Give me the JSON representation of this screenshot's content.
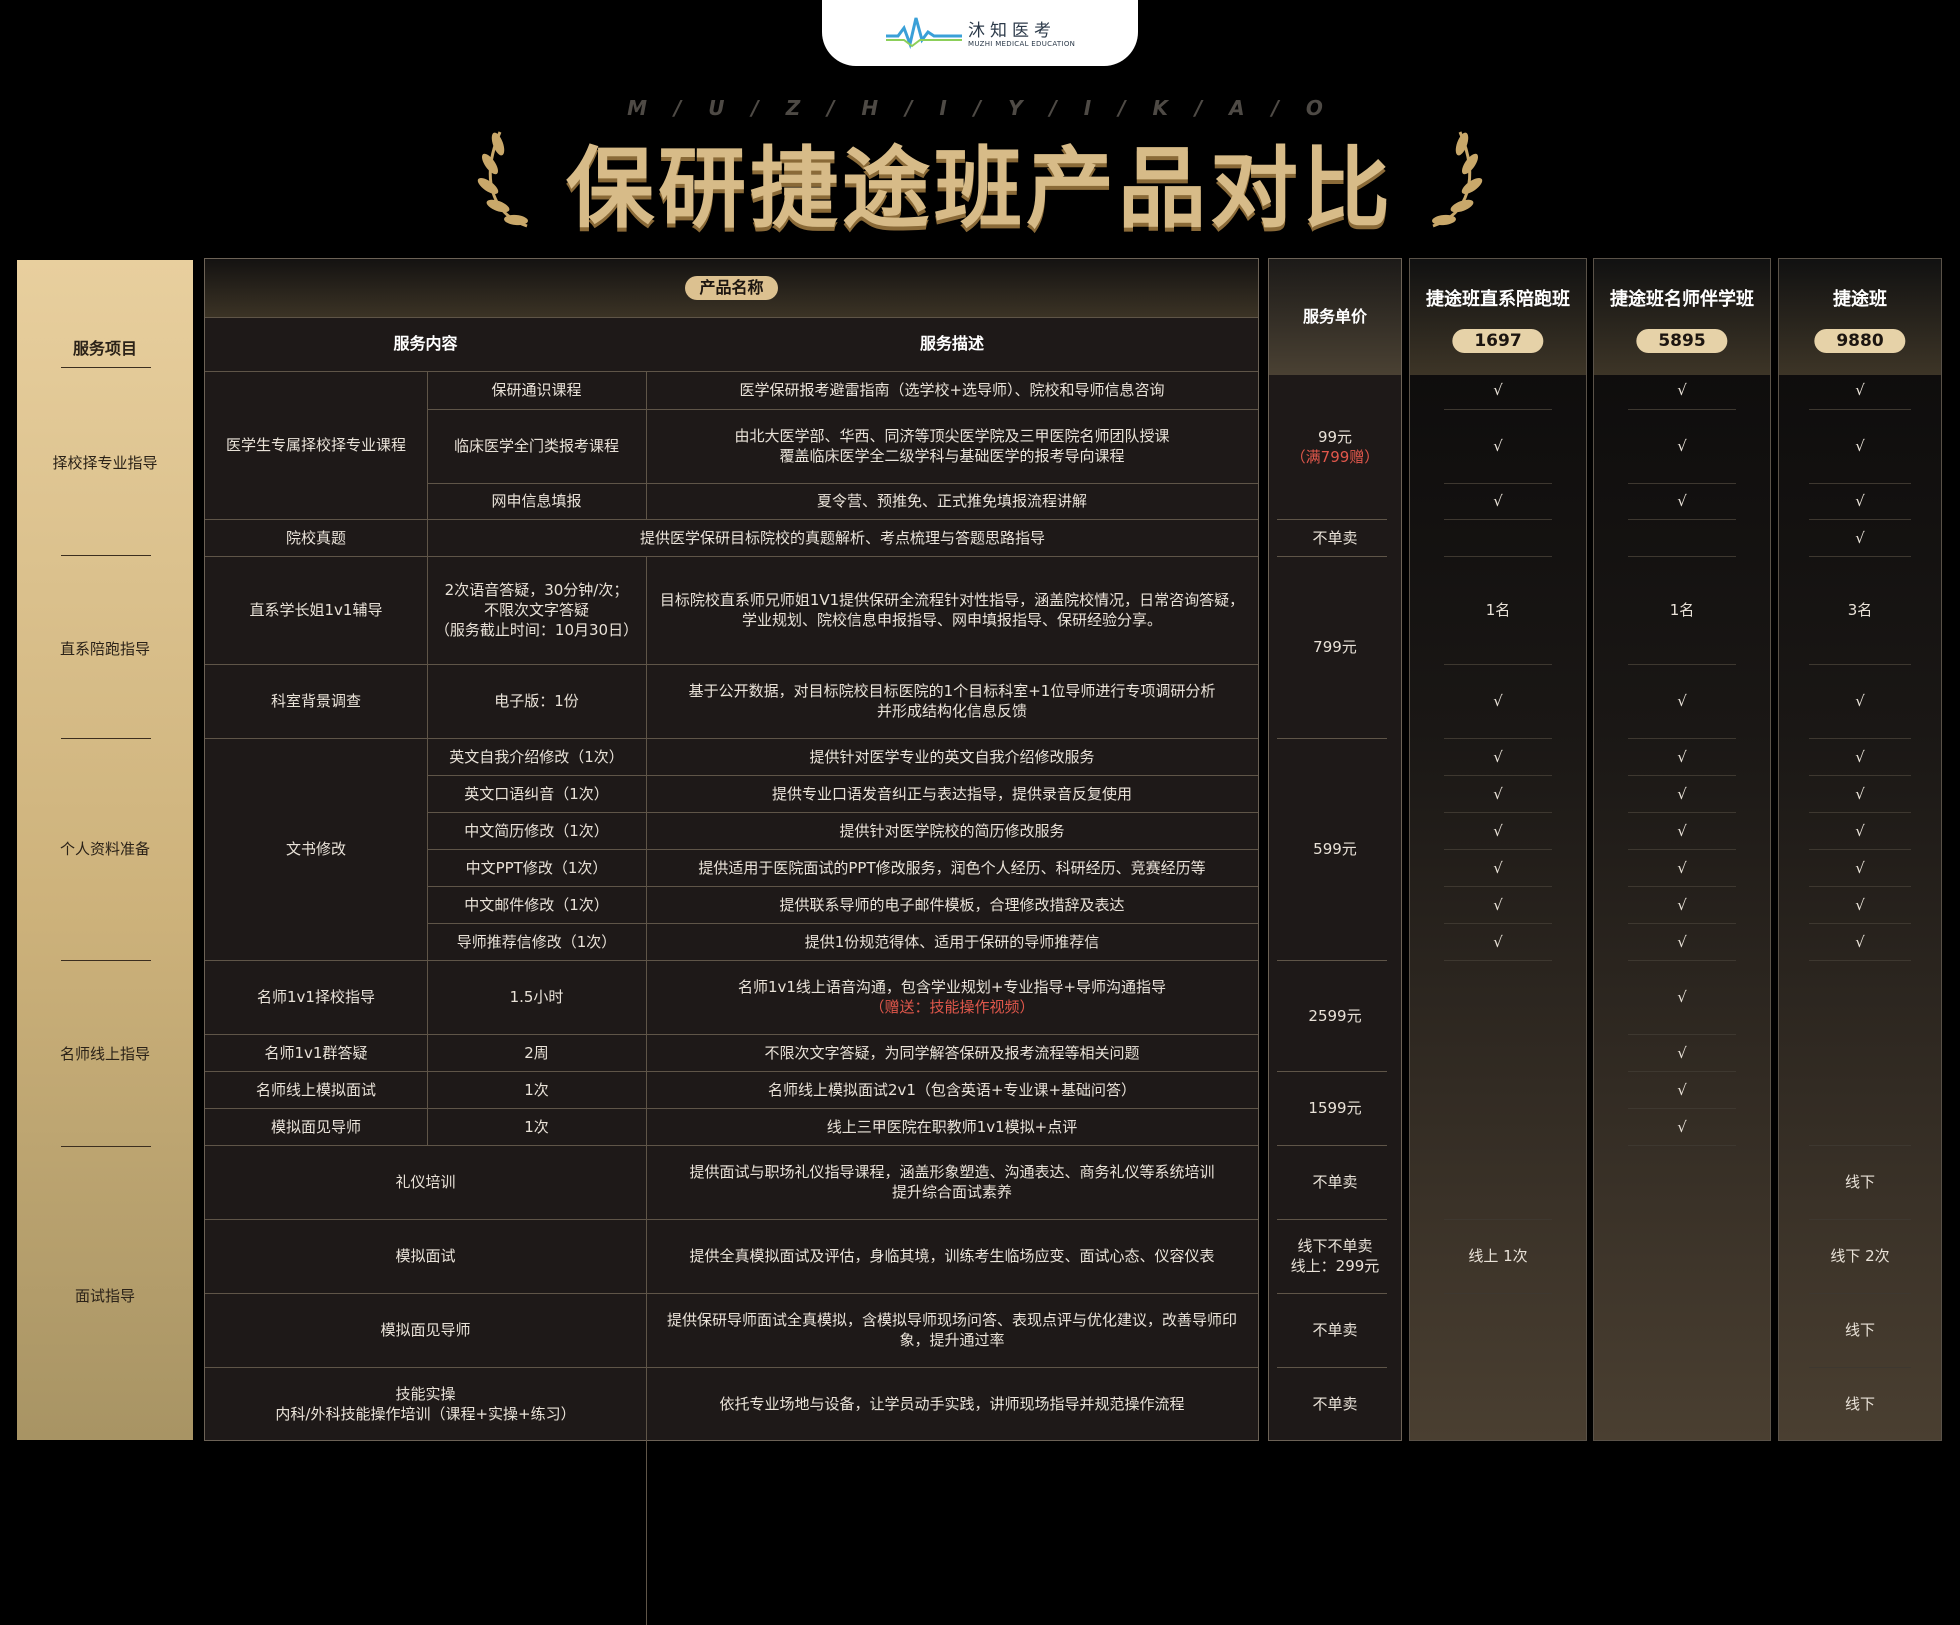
{
  "logo": {
    "name_cn": "沐知医考",
    "name_en": "MUZHI MEDICAL EDUCATION"
  },
  "header": {
    "spaced": "M / U / Z / H / I / Y / I / K / A / O",
    "title": "保研捷途班产品对比"
  },
  "left": {
    "head": "服务项目",
    "sections": [
      "择校择专业指导",
      "直系陪跑指导",
      "个人资料准备",
      "名师线上指导",
      "面试指导"
    ]
  },
  "table": {
    "product_label": "产品名称",
    "col_content": "服务内容",
    "col_desc": "服务描述",
    "price_head": "服务单价",
    "groups": {
      "g1": "医学生专属择校择专业课程",
      "g2": "院校真题",
      "g3": "直系学长姐1v1辅导",
      "g4": "科室背景调查",
      "g5": "文书修改",
      "g6": "名师1v1择校指导",
      "g7": "名师1v1群答疑",
      "g8": "名师线上模拟面试",
      "g9": "模拟面见导师",
      "g10": "礼仪培训",
      "g11": "模拟面试",
      "g12": "模拟面见导师",
      "g13a": "技能实操",
      "g13b": "内科/外科技能操作培训（课程+实操+练习）"
    },
    "sub": {
      "s1": "保研通识课程",
      "s2": "临床医学全门类报考课程",
      "s3": "网申信息填报",
      "s4a": "2次语音答疑，30分钟/次；",
      "s4b": "不限次文字答疑",
      "s4c": "（服务截止时间：10月30日）",
      "s5": "电子版：1份",
      "s6": "英文自我介绍修改（1次）",
      "s7": "英文口语纠音（1次）",
      "s8": "中文简历修改（1次）",
      "s9": "中文PPT修改（1次）",
      "s10": "中文邮件修改（1次）",
      "s11": "导师推荐信修改（1次）",
      "s12": "1.5小时",
      "s13": "2周",
      "s14": "1次",
      "s15": "1次"
    },
    "desc": {
      "d1": "医学保研报考避雷指南（选学校+选导师）、院校和导师信息咨询",
      "d2a": "由北大医学部、华西、同济等顶尖医学院及三甲医院名师团队授课",
      "d2b": "覆盖临床医学全二级学科与基础医学的报考导向课程",
      "d3": "夏令营、预推免、正式推免填报流程讲解",
      "d4": "提供医学保研目标院校的真题解析、考点梳理与答题思路指导",
      "d5a": "目标院校直系师兄师姐1V1提供保研全流程针对性指导，涵盖院校情况，日常咨询答疑，",
      "d5b": "学业规划、院校信息申报指导、网申填报指导、保研经验分享。",
      "d6a": "基于公开数据，对目标院校目标医院的1个目标科室+1位导师进行专项调研分析",
      "d6b": "并形成结构化信息反馈",
      "d7": "提供针对医学专业的英文自我介绍修改服务",
      "d8": "提供专业口语发音纠正与表达指导，提供录音反复使用",
      "d9": "提供针对医学院校的简历修改服务",
      "d10": "提供适用于医院面试的PPT修改服务，润色个人经历、科研经历、竞赛经历等",
      "d11": "提供联系导师的电子邮件模板，合理修改措辞及表达",
      "d12": "提供1份规范得体、适用于保研的导师推荐信",
      "d13a": "名师1v1线上语音沟通，包含学业规划+专业指导+导师沟通指导",
      "d13b": "（赠送：技能操作视频）",
      "d14": "不限次文字答疑，为同学解答保研及报考流程等相关问题",
      "d15": "名师线上模拟面试2v1（包含英语+专业课+基础问答）",
      "d16": "线上三甲医院在职教师1v1模拟+点评",
      "d17a": "提供面试与职场礼仪指导课程，涵盖形象塑造、沟通表达、商务礼仪等系统培训",
      "d17b": "提升综合面试素养",
      "d18": "提供全真模拟面试及评估，身临其境，训练考生临场应变、面试心态、仪容仪表",
      "d19a": "提供保研导师面试全真模拟，含模拟导师现场问答、表现点评与优化建议，改善导师印",
      "d19b": "象，提升通过率",
      "d20": "依托专业场地与设备，让学员动手实践，讲师现场指导并规范操作流程"
    },
    "prices": {
      "p1a": "99元",
      "p1b": "（满799赠）",
      "p2": "不单卖",
      "p3": "799元",
      "p4": "599元",
      "p5": "2599元",
      "p6": "1599元",
      "p7": "不单卖",
      "p8a": "线下不单卖",
      "p8b": "线上：299元",
      "p9": "不单卖",
      "p10": "不单卖"
    }
  },
  "products": [
    {
      "name": "捷途班直系陪跑班",
      "price": "1697"
    },
    {
      "name": "捷途班名师伴学班",
      "price": "5895"
    },
    {
      "name": "捷途班",
      "price": "9880"
    }
  ],
  "marks": {
    "check": "√",
    "one": "1名",
    "three": "3名",
    "online1": "线上 1次",
    "offline": "线下",
    "offline2": "线下 2次"
  }
}
